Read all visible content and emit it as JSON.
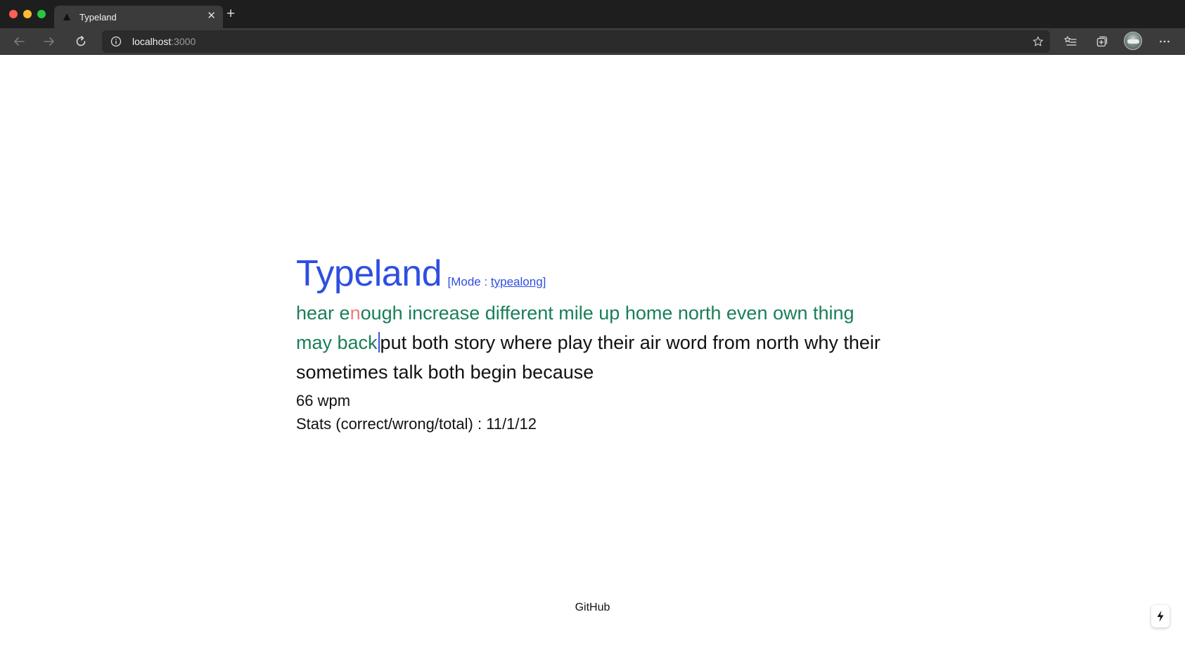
{
  "browser": {
    "tab": {
      "title": "Typeland"
    },
    "url": {
      "host": "localhost",
      "port": ":3000"
    }
  },
  "app": {
    "title": "Typeland",
    "mode_prefix": "[Mode : ",
    "mode_value": "typealong",
    "mode_suffix": "]"
  },
  "typing": {
    "typed_before_error": "hear e",
    "error_char": "n",
    "typed_after_error": "ough increase different mile up home north even own thing may back",
    "remaining": "put both story where play their air word from north why their sometimes talk both begin because"
  },
  "stats": {
    "wpm": "66 wpm",
    "summary": "Stats (correct/wrong/total) : 11/1/12"
  },
  "footer": {
    "link": "GitHub"
  },
  "colors": {
    "accent": "#2f4fe0",
    "typed": "#1a7f58",
    "error": "#ef7c7c",
    "text": "#111111"
  },
  "icons": {
    "back": "back-arrow-icon",
    "forward": "forward-arrow-icon",
    "reload": "reload-icon",
    "info": "info-icon",
    "favorite": "star-icon",
    "favorites": "favorites-list-icon",
    "collections": "collections-icon",
    "more": "more-icon",
    "quick": "lightning-icon"
  }
}
